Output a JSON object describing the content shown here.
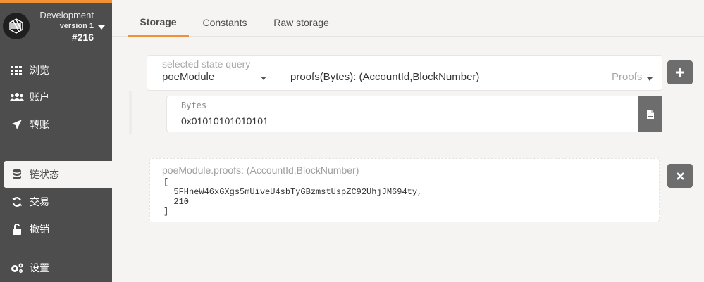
{
  "chain": {
    "name": "Development",
    "version": "version 1",
    "block": "#216"
  },
  "sidebar": {
    "items": [
      {
        "label": "浏览",
        "icon": "th-icon"
      },
      {
        "label": "账户",
        "icon": "users-icon"
      },
      {
        "label": "转账",
        "icon": "send-icon"
      },
      {
        "label": "链状态",
        "icon": "database-icon"
      },
      {
        "label": "交易",
        "icon": "sync-icon"
      },
      {
        "label": "撤销",
        "icon": "unlock-icon"
      },
      {
        "label": "设置",
        "icon": "cogs-icon"
      }
    ]
  },
  "tabs": [
    {
      "label": "Storage"
    },
    {
      "label": "Constants"
    },
    {
      "label": "Raw storage"
    }
  ],
  "query": {
    "label": "selected state query",
    "module": "poeModule",
    "method": "proofs(Bytes): (AccountId,BlockNumber)",
    "doc": "Proofs"
  },
  "param": {
    "label": "Bytes",
    "value": "0x01010101010101"
  },
  "result": {
    "title": "poeModule.proofs: (AccountId,BlockNumber)",
    "body": "[\n  5FHneW46xGXgs5mUiveU4sbTyGBzmstUspZC92UhjJM694ty,\n  210\n]"
  },
  "colors": {
    "accent": "#f19135",
    "sidebar_bg": "#4d4d4d",
    "button_bg": "#6d6d6d"
  }
}
